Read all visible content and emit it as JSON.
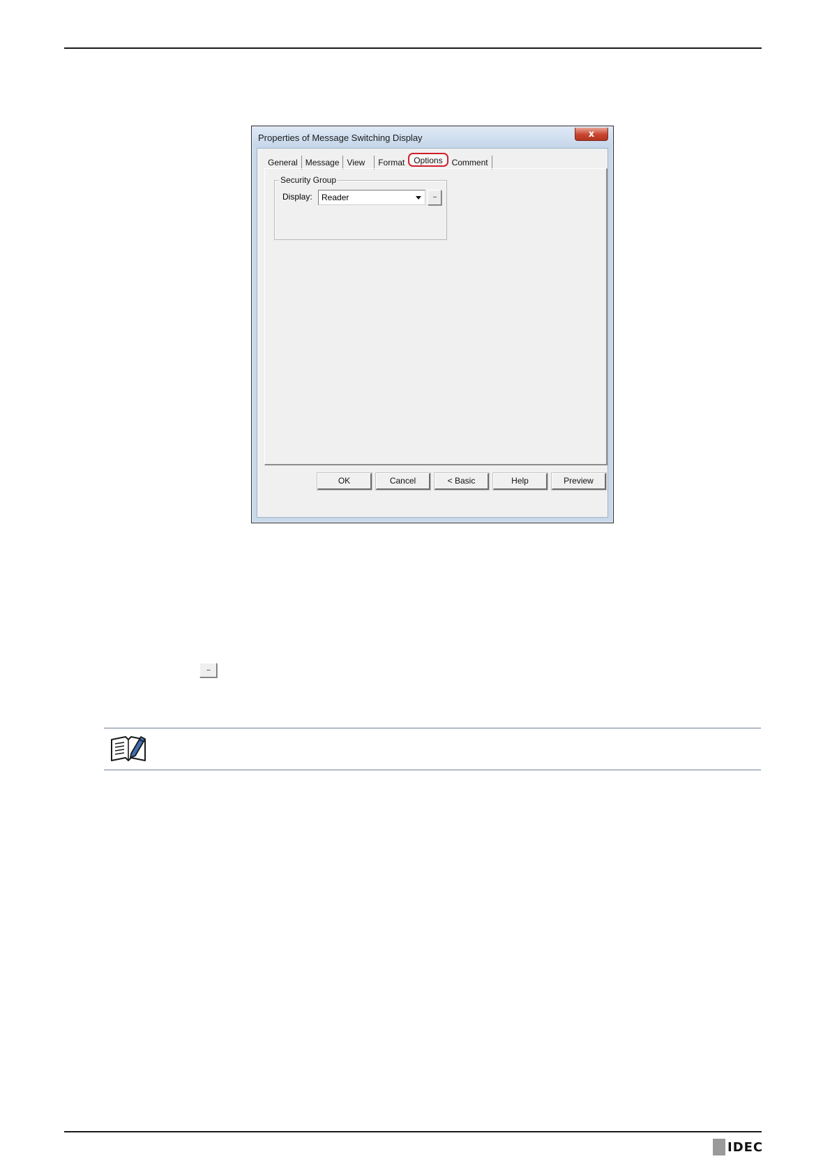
{
  "dialog": {
    "title": "Properties of Message Switching Display",
    "close_glyph": "x",
    "tabs": [
      {
        "label": "General"
      },
      {
        "label": "Message"
      },
      {
        "label": "View"
      },
      {
        "label": "Format"
      },
      {
        "label": "Options"
      },
      {
        "label": "Comment"
      }
    ],
    "active_tab": "Options",
    "security_group": {
      "legend": "Security Group",
      "display_label": "Display:",
      "display_value": "Reader",
      "browse_label": "..."
    },
    "buttons": {
      "ok": "OK",
      "cancel": "Cancel",
      "basic": "< Basic",
      "help": "Help",
      "preview": "Preview"
    }
  },
  "inline_button": {
    "label": "..."
  },
  "note": {
    "icon": "note-pencil-icon"
  },
  "footer": {
    "logo": "IDEC"
  }
}
